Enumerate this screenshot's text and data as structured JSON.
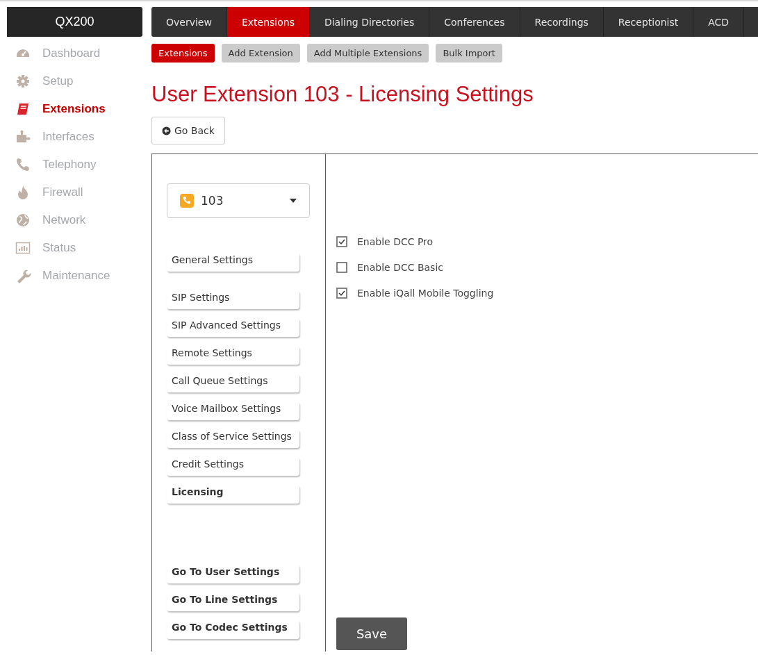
{
  "sidebar": {
    "brand": "QX200",
    "items": [
      {
        "label": "Dashboard",
        "selected": false
      },
      {
        "label": "Setup",
        "selected": false
      },
      {
        "label": "Extensions",
        "selected": true
      },
      {
        "label": "Interfaces",
        "selected": false
      },
      {
        "label": "Telephony",
        "selected": false
      },
      {
        "label": "Firewall",
        "selected": false
      },
      {
        "label": "Network",
        "selected": false
      },
      {
        "label": "Status",
        "selected": false
      },
      {
        "label": "Maintenance",
        "selected": false
      }
    ]
  },
  "top_tabs": [
    {
      "label": "Overview",
      "selected": false
    },
    {
      "label": "Extensions",
      "selected": true
    },
    {
      "label": "Dialing Directories",
      "selected": false
    },
    {
      "label": "Conferences",
      "selected": false
    },
    {
      "label": "Recordings",
      "selected": false
    },
    {
      "label": "Receptionist",
      "selected": false
    },
    {
      "label": "ACD",
      "selected": false
    }
  ],
  "sub_tabs": [
    {
      "label": "Extensions",
      "selected": true
    },
    {
      "label": "Add Extension",
      "selected": false
    },
    {
      "label": "Add Multiple Extensions",
      "selected": false
    },
    {
      "label": "Bulk Import",
      "selected": false
    }
  ],
  "title": "User Extension 103 - Licensing Settings",
  "back_button": "Go Back",
  "extension_select": {
    "value": "103"
  },
  "settings_menu": [
    {
      "label": "General Settings",
      "selected": false
    },
    {
      "label": "SIP Settings",
      "selected": false
    },
    {
      "label": "SIP Advanced Settings",
      "selected": false
    },
    {
      "label": "Remote Settings",
      "selected": false
    },
    {
      "label": "Call Queue Settings",
      "selected": false
    },
    {
      "label": "Voice Mailbox Settings",
      "selected": false
    },
    {
      "label": "Class of Service Settings",
      "selected": false
    },
    {
      "label": "Credit Settings",
      "selected": false
    },
    {
      "label": "Licensing",
      "selected": true
    }
  ],
  "goto_links": [
    "Go To User Settings",
    "Go To Line Settings",
    "Go To Codec Settings"
  ],
  "options": [
    {
      "label": "Enable DCC Pro",
      "checked": true
    },
    {
      "label": "Enable DCC Basic",
      "checked": false
    },
    {
      "label": "Enable iQall Mobile Toggling",
      "checked": true
    }
  ],
  "save_button": "Save"
}
